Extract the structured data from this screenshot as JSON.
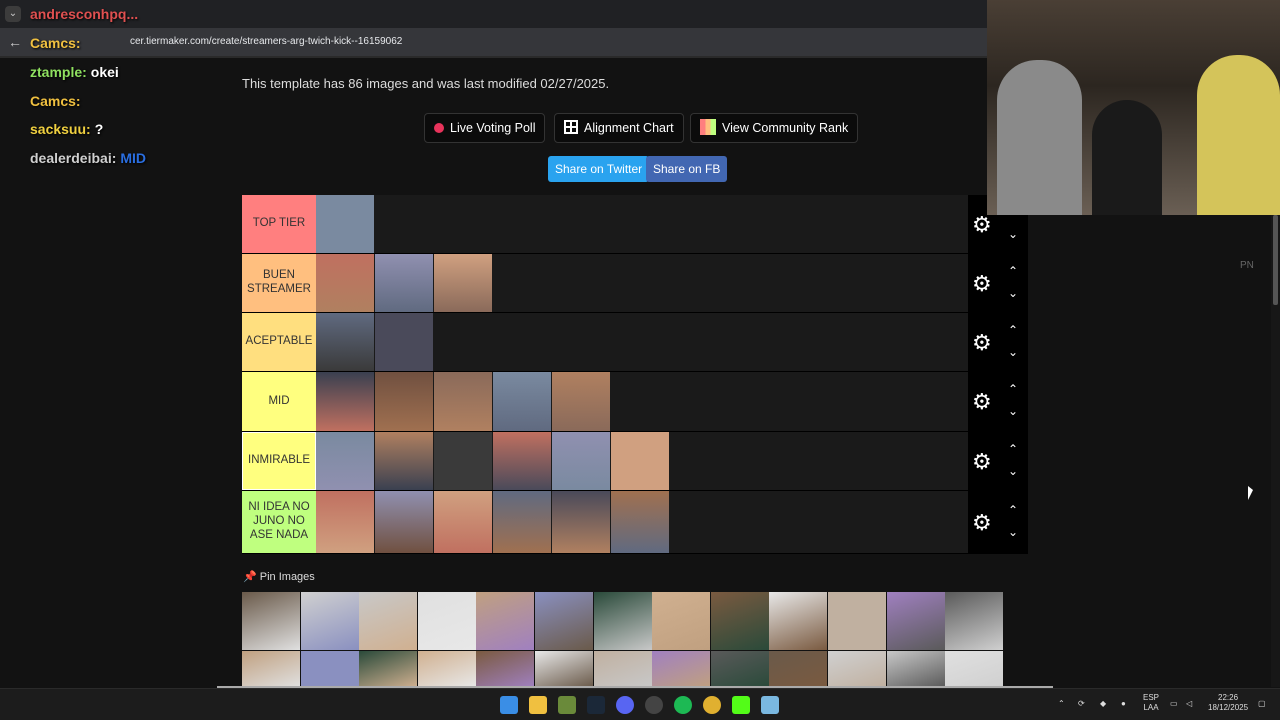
{
  "browser": {
    "url": "tiermaker.com/create/streamers-arg-twich-kick--16159062",
    "url_prefix": "cer"
  },
  "chat": [
    {
      "user": "andresconhpq...",
      "msg": "",
      "color": "#e05050"
    },
    {
      "user": "Camcs:",
      "msg": "",
      "color": "#f0c040"
    },
    {
      "user": "ztample:",
      "msg": "okei",
      "color": "#8fe060"
    },
    {
      "user": "Camcs:",
      "msg": "",
      "color": "#f0c040"
    },
    {
      "user": "sacksuu:",
      "msg": "?",
      "color": "#f0d040"
    },
    {
      "user": "dealerdeibai:",
      "msg": "MID",
      "color": "#d0d0d0"
    }
  ],
  "page": {
    "info": "This template has 86 images and was last modified 02/27/2025.",
    "buttons": {
      "live_voting": "Live Voting Poll",
      "alignment": "Alignment Chart",
      "community_rank": "View Community Rank",
      "share_twitter": "Share on Twitter",
      "share_fb": "Share on FB"
    },
    "pin_images": "Pin Images"
  },
  "tiers": [
    {
      "label": "TOP TIER",
      "color": "#ff7f7f",
      "count": 1
    },
    {
      "label": "BUEN STREAMER",
      "color": "#ffbf7f",
      "count": 3
    },
    {
      "label": "ACEPTABLE",
      "color": "#ffdf7f",
      "count": 2
    },
    {
      "label": "MID",
      "color": "#ffff7f",
      "count": 5
    },
    {
      "label": "INMIRABLE",
      "color": "#ffff7f",
      "count": 6
    },
    {
      "label": "NI IDEA NO JUNO NO ASE NADA",
      "color": "#bfff7f",
      "count": 6
    }
  ],
  "taskbar": {
    "lang": "ESP",
    "layout": "LAA",
    "time": "22:26",
    "date": "18/12/2025"
  },
  "overlay": {
    "pn": "PN"
  }
}
